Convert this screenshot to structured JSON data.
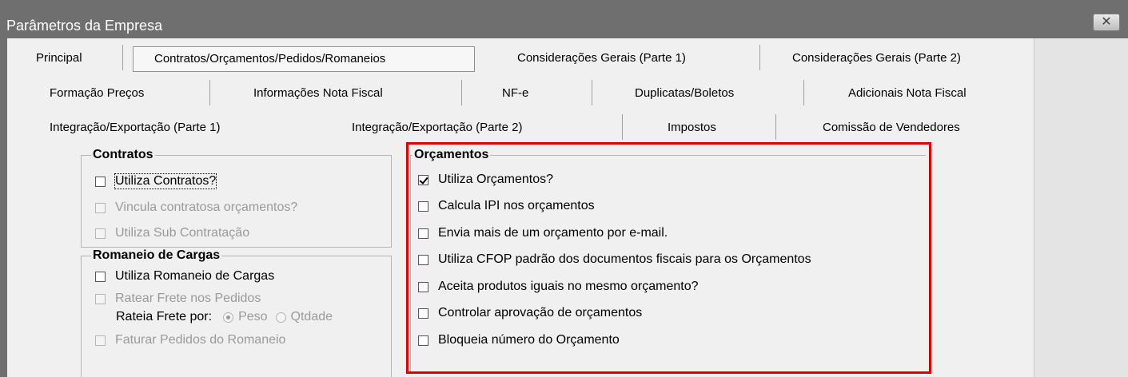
{
  "window": {
    "title": "Parâmetros da Empresa",
    "close_glyph": "✕"
  },
  "tabs": {
    "row1": [
      "Principal",
      "Contratos/Orçamentos/Pedidos/Romaneios",
      "Considerações Gerais (Parte 1)",
      "Considerações Gerais (Parte 2)"
    ],
    "row2": [
      "Formação Preços",
      "Informações Nota Fiscal",
      "NF-e",
      "Duplicatas/Boletos",
      "Adicionais Nota Fiscal"
    ],
    "row3": [
      "Integração/Exportação (Parte 1)",
      "Integração/Exportação (Parte 2)",
      "Impostos",
      "Comissão de Vendedores"
    ],
    "active": "Contratos/Orçamentos/Pedidos/Romaneios"
  },
  "contratos": {
    "legend": "Contratos",
    "items": [
      {
        "label": "Utiliza Contratos?",
        "checked": false,
        "enabled": true
      },
      {
        "label": "Vincula contratosa orçamentos?",
        "checked": false,
        "enabled": false
      },
      {
        "label": "Utiliza Sub Contratação",
        "checked": false,
        "enabled": false
      }
    ]
  },
  "romaneio": {
    "legend": "Romaneio de Cargas",
    "items": [
      {
        "label": "Utiliza Romaneio de Cargas",
        "checked": false,
        "enabled": true
      },
      {
        "label": "Ratear Frete nos Pedidos",
        "checked": false,
        "enabled": false
      },
      {
        "label": "Faturar Pedidos do Romaneio",
        "checked": false,
        "enabled": false
      }
    ],
    "rateia_label": "Rateia Frete por:",
    "radio_options": [
      "Peso",
      "Qtdade"
    ],
    "radio_selected": "Peso"
  },
  "orcamentos": {
    "legend": "Orçamentos",
    "items": [
      {
        "label": "Utiliza Orçamentos?",
        "checked": true,
        "enabled": true
      },
      {
        "label": "Calcula IPI nos orçamentos",
        "checked": false,
        "enabled": true
      },
      {
        "label": "Envia mais de um orçamento por e-mail.",
        "checked": false,
        "enabled": true
      },
      {
        "label": "Utiliza CFOP padrão dos documentos fiscais para os Orçamentos",
        "checked": false,
        "enabled": true
      },
      {
        "label": "Aceita produtos iguais no mesmo orçamento?",
        "checked": false,
        "enabled": true
      },
      {
        "label": "Controlar aprovação de orçamentos",
        "checked": false,
        "enabled": true
      },
      {
        "label": "Bloqueia número do Orçamento",
        "checked": false,
        "enabled": true
      }
    ]
  },
  "colors": {
    "highlight": "#e00000",
    "titlebar": "#6f6f6f"
  }
}
